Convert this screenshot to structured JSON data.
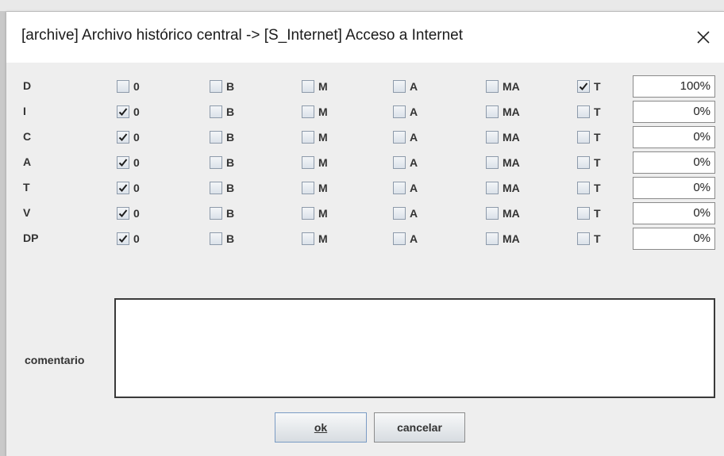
{
  "window": {
    "title": "[archive] Archivo histórico central -> [S_Internet] Acceso a Internet",
    "close_icon": "close-icon"
  },
  "options": [
    "0",
    "B",
    "M",
    "A",
    "MA",
    "T"
  ],
  "rows": [
    {
      "label": "D",
      "checked": "T",
      "percent": "100%"
    },
    {
      "label": "I",
      "checked": "0",
      "percent": "0%"
    },
    {
      "label": "C",
      "checked": "0",
      "percent": "0%"
    },
    {
      "label": "A",
      "checked": "0",
      "percent": "0%"
    },
    {
      "label": "T",
      "checked": "0",
      "percent": "0%"
    },
    {
      "label": "V",
      "checked": "0",
      "percent": "0%"
    },
    {
      "label": "DP",
      "checked": "0",
      "percent": "0%"
    }
  ],
  "comment": {
    "label": "comentario",
    "value": ""
  },
  "buttons": {
    "ok_label": "ok",
    "cancel_label": "cancelar"
  },
  "colors": {
    "dialog_bg": "#eeeeee",
    "titlebar_bg": "#ffffff",
    "text": "#333333"
  }
}
